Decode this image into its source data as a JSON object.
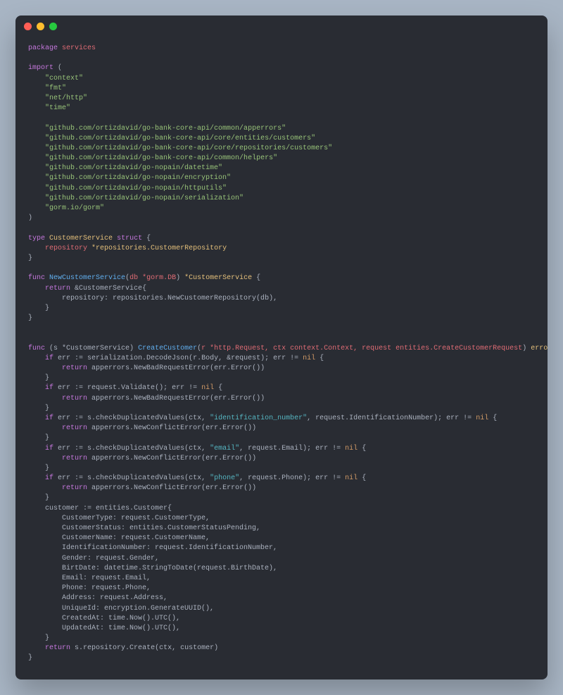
{
  "package_kw": "package",
  "package_name": "services",
  "import_kw": "import",
  "imports": [
    "context",
    "fmt",
    "net/http",
    "time",
    "",
    "github.com/ortizdavid/go-bank-core-api/common/apperrors",
    "github.com/ortizdavid/go-bank-core-api/core/entities/customers",
    "github.com/ortizdavid/go-bank-core-api/core/repositories/customers",
    "github.com/ortizdavid/go-bank-core-api/common/helpers",
    "github.com/ortizdavid/go-nopain/datetime",
    "github.com/ortizdavid/go-nopain/encryption",
    "github.com/ortizdavid/go-nopain/httputils",
    "github.com/ortizdavid/go-nopain/serialization",
    "gorm.io/gorm"
  ],
  "type_kw": "type",
  "struct_kw": "struct",
  "struct_name": "CustomerService",
  "struct_field": "repository",
  "struct_field_type": "*repositories.CustomerRepository",
  "func_kw": "func",
  "return_kw": "return",
  "if_kw": "if",
  "nil_kw": "nil",
  "new_fn": "NewCustomerService",
  "new_fn_param": "db *gorm.DB",
  "new_fn_ret": "*CustomerService",
  "new_fn_body1": "&CustomerService{",
  "new_fn_body2": "repository: repositories.NewCustomerRepository(db),",
  "create_fn": "CreateCustomer",
  "create_recv": "(s *CustomerService)",
  "create_params": "r *http.Request, ctx context.Context, request entities.CreateCustomerRequest",
  "create_ret": "error",
  "decode_line": "serialization.DecodeJson(r.Body, &request)",
  "err_ne_nil": "err != nil",
  "badreq": "apperrors.NewBadRequestError(err.Error())",
  "conflict": "apperrors.NewConflictError(err.Error())",
  "validate": "request.Validate()",
  "check_dup": "s.checkDuplicatedValues",
  "dup1_key": "\"identification_number\"",
  "dup1_val": "request.IdentificationNumber",
  "dup2_key": "\"email\"",
  "dup2_val": "request.Email",
  "dup3_key": "\"phone\"",
  "dup3_val": "request.Phone",
  "cust_decl": "customer := entities.Customer{",
  "fields": [
    "CustomerType: request.CustomerType,",
    "CustomerStatus: entities.CustomerStatusPending,",
    "CustomerName: request.CustomerName,",
    "IdentificationNumber: request.IdentificationNumber,",
    "Gender: request.Gender,",
    "BirtDate: datetime.StringToDate(request.BirthDate),",
    "Email: request.Email,",
    "Phone: request.Phone,",
    "Address: request.Address,",
    "UniqueId: encryption.GenerateUUID(),",
    "CreatedAt: time.Now().UTC(),",
    "UpdatedAt: time.Now().UTC(),"
  ],
  "final_return": "s.repository.Create(ctx, customer)"
}
